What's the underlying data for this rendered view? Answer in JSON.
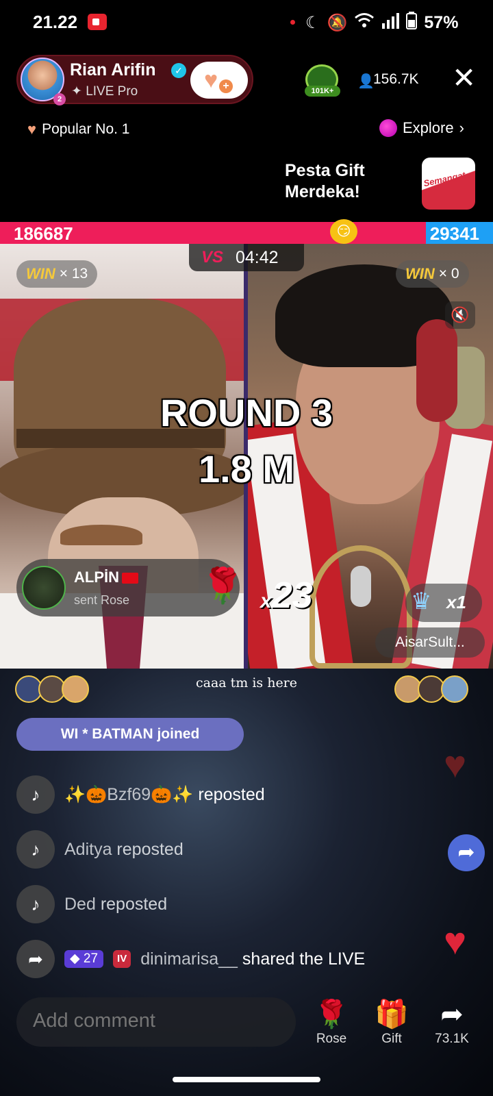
{
  "status": {
    "time": "21.22",
    "battery": "57%",
    "icons": [
      "record-icon",
      "moon-icon",
      "bell-off-icon",
      "wifi-icon",
      "signal-icon",
      "battery-icon"
    ]
  },
  "host": {
    "name": "Rian Arifin",
    "subtitle": "LIVE Pro",
    "level_badge": "2"
  },
  "rank_badge": "101K+",
  "viewers": "156.7K",
  "popular": "Popular No. 1",
  "explore": "Explore",
  "promo": {
    "line1": "Pesta Gift",
    "line2": "Merdeka!",
    "logo_text": "Semangat"
  },
  "battle": {
    "score_left": "186687",
    "score_right": "29341",
    "score_left_fraction": 0.864,
    "timer": "04:42",
    "vs_label": "VS",
    "win_label": "WIN",
    "win_left": "× 13",
    "win_right": "× 0",
    "round": "ROUND 3",
    "round_value": "1.8 M"
  },
  "gift_notice": {
    "user": "ALPİN",
    "text": "sent Rose"
  },
  "combo": {
    "prefix": "x",
    "count": "23"
  },
  "gift2": {
    "count": "x1",
    "sender": "AisarSult..."
  },
  "banner": "caaa tm is here",
  "joined": "WI * BATMAN joined",
  "chat": [
    {
      "user": "✨🎃Bzf69🎃✨",
      "action": " reposted",
      "icon": "tiktok-icon"
    },
    {
      "user": "Aditya",
      "action": " reposted",
      "icon": "tiktok-icon"
    },
    {
      "user": "Ded",
      "action": " reposted",
      "icon": "tiktok-icon"
    },
    {
      "user": "dinimarisa__",
      "action": " shared the LIVE",
      "icon": "share-icon",
      "level": "27",
      "badge": "IV"
    }
  ],
  "comment": {
    "placeholder": "Add comment"
  },
  "actions": {
    "rose": "Rose",
    "gift": "Gift",
    "share": "73.1K"
  },
  "colors": {
    "red_team": "#ee1e5a",
    "blue_team": "#1ea0f5",
    "win": "#f5c93b"
  }
}
